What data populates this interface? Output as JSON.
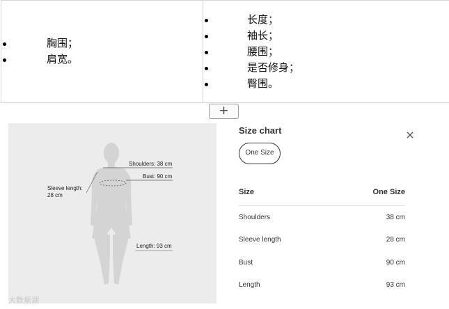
{
  "doc": {
    "left_items": [
      "胸围；",
      "肩宽。"
    ],
    "right_items": [
      "长度；",
      "袖长；",
      "腰围；",
      "是否修身；",
      "臀围。"
    ],
    "add_button": "+"
  },
  "figure": {
    "shoulders": "Shoulders: 38 cm",
    "bust": "Bust: 90 cm",
    "sleeve_line1": "Sleeve length:",
    "sleeve_line2": "28 cm",
    "length": "Length: 93 cm"
  },
  "size_chart": {
    "title": "Size chart",
    "selected_size": "One Size",
    "header": {
      "label": "Size",
      "value": "One Size"
    },
    "rows": [
      {
        "label": "Shoulders",
        "value": "38 cm"
      },
      {
        "label": "Sleeve length",
        "value": "28 cm"
      },
      {
        "label": "Bust",
        "value": "90 cm"
      },
      {
        "label": "Length",
        "value": "93 cm"
      }
    ]
  },
  "watermark": "大数据湖"
}
